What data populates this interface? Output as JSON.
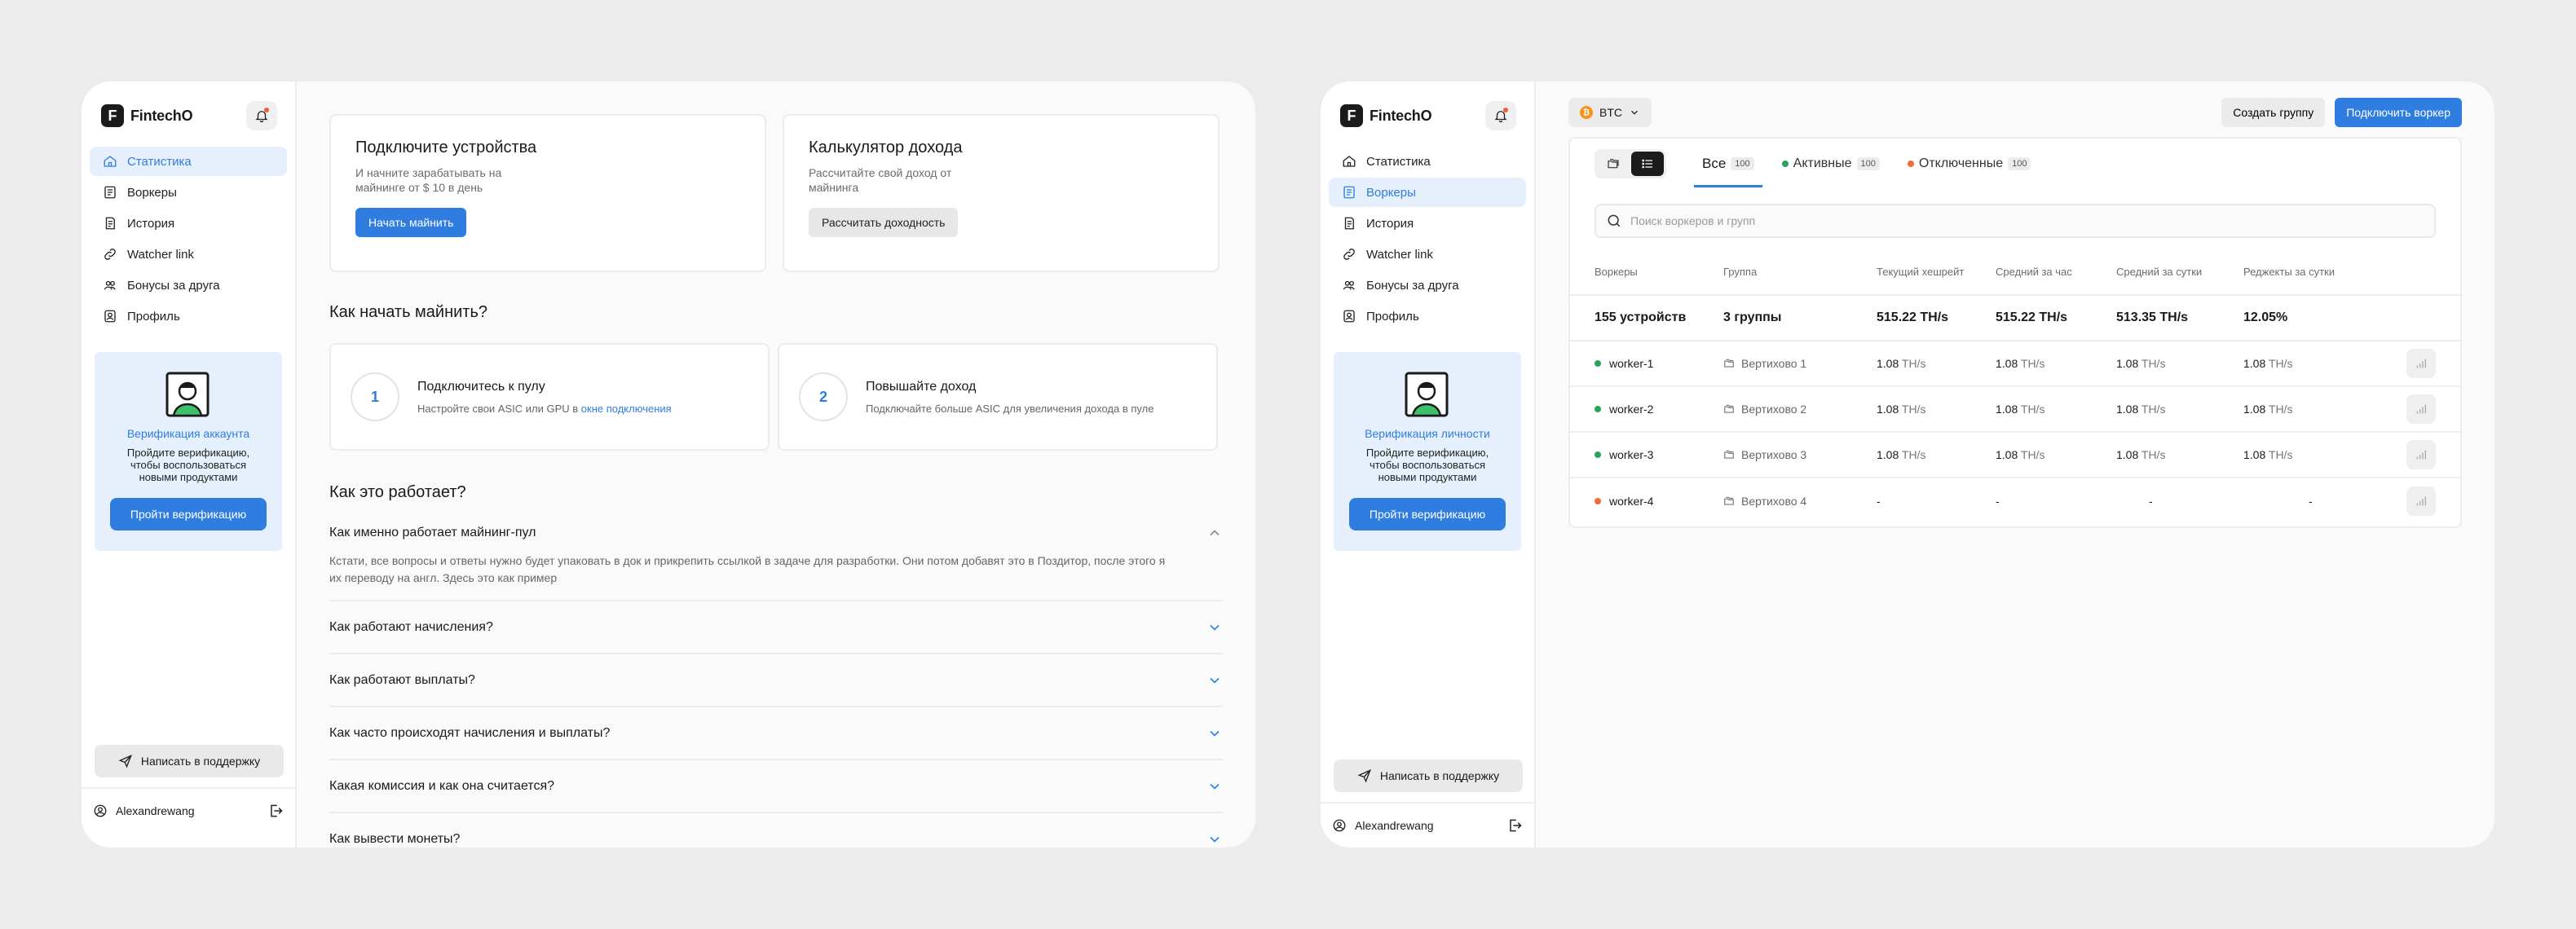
{
  "brand": {
    "name": "FintechO",
    "mark": "F"
  },
  "nav": {
    "items": [
      {
        "label": "Статистика"
      },
      {
        "label": "Воркеры"
      },
      {
        "label": "История"
      },
      {
        "label": "Watcher link"
      },
      {
        "label": "Бонусы за друга"
      },
      {
        "label": "Профиль"
      }
    ]
  },
  "verify_a": {
    "title": "Верификация аккаунта",
    "text": "Пройдите верификацию, чтобы воспользоваться новыми продуктами",
    "button": "Пройти верификацию"
  },
  "verify_b": {
    "title": "Верификация личности",
    "text": "Пройдите верификацию, чтобы воспользоваться новыми продуктами",
    "button": "Пройти верификацию"
  },
  "support_label": "Написать в поддержку",
  "user": {
    "name": "Alexandrewang"
  },
  "dashboard": {
    "connect_card": {
      "title": "Подключите устройства",
      "subtitle": "И начните зарабатывать на майнинге от $ 10 в день",
      "button": "Начать майнить"
    },
    "calc_card": {
      "title": "Калькулятор дохода",
      "subtitle": "Рассчитайте свой доход от майнинга",
      "button": "Рассчитать доходность"
    },
    "how_start_title": "Как начать майнить?",
    "steps": [
      {
        "num": "1",
        "title": "Подключитесь к пулу",
        "text": "Настройте свои ASIC или GPU в ",
        "link": "окне подключения"
      },
      {
        "num": "2",
        "title": "Повышайте доход",
        "text": "Подключайте больше ASIC для увеличения дохода в пуле",
        "link": ""
      }
    ],
    "how_works_title": "Как это работает?",
    "faq_open": {
      "question": "Как именно работает майнинг-пул",
      "answer": "Кстати, все вопросы и ответы нужно будет упаковать в док и прикрепить ссылкой в задаче для разработки. Они потом добавят это в Поздитор, после этого я их переводу на англ. Здесь это как пример"
    },
    "faq": [
      {
        "question": "Как работают начисления?"
      },
      {
        "question": "Как работают выплаты?"
      },
      {
        "question": "Как часто происходят начисления и выплаты?"
      },
      {
        "question": "Какая комиссия и как она считается?"
      },
      {
        "question": "Как вывести монеты?"
      }
    ]
  },
  "workers_page": {
    "coin": {
      "label": "BTC",
      "symbol": "₿"
    },
    "create_group": "Создать группу",
    "connect_worker": "Подключить воркер",
    "tabs": [
      {
        "label": "Все",
        "count": "100"
      },
      {
        "label": "Активные",
        "count": "100",
        "dot": "#27a35a"
      },
      {
        "label": "Отключенные",
        "count": "100",
        "dot": "#f26b3a"
      }
    ],
    "search_placeholder": "Поиск воркеров и групп",
    "columns": [
      "Воркеры",
      "Группа",
      "Текущий хешрейт",
      "Средний за час",
      "Средний за сутки",
      "Реджекты за сутки"
    ],
    "summary": {
      "devices": "155 устройств",
      "groups": "3 группы",
      "current": "515.22 TH/s",
      "hour": "515.22 TH/s",
      "day": "513.35 TH/s",
      "rejects": "12.05%"
    },
    "rows": [
      {
        "name": "worker-1",
        "status_color": "#27a35a",
        "group": "Вертихово 1",
        "current": "1.08",
        "hour": "1.08",
        "day": "1.08",
        "rejects": "1.08",
        "unit": "TH/s"
      },
      {
        "name": "worker-2",
        "status_color": "#27a35a",
        "group": "Вертихово 2",
        "current": "1.08",
        "hour": "1.08",
        "day": "1.08",
        "rejects": "1.08",
        "unit": "TH/s"
      },
      {
        "name": "worker-3",
        "status_color": "#27a35a",
        "group": "Вертихово 3",
        "current": "1.08",
        "hour": "1.08",
        "day": "1.08",
        "rejects": "1.08",
        "unit": "TH/s"
      },
      {
        "name": "worker-4",
        "status_color": "#f26b3a",
        "group": "Вертихово 4",
        "current": "-",
        "hour": "-",
        "day": "-",
        "rejects": "-",
        "unit": ""
      }
    ]
  },
  "colors": {
    "accent": "#2f7de1",
    "accent_soft": "#e6f0fd",
    "active": "#27a35a",
    "offline": "#f26b3a"
  }
}
